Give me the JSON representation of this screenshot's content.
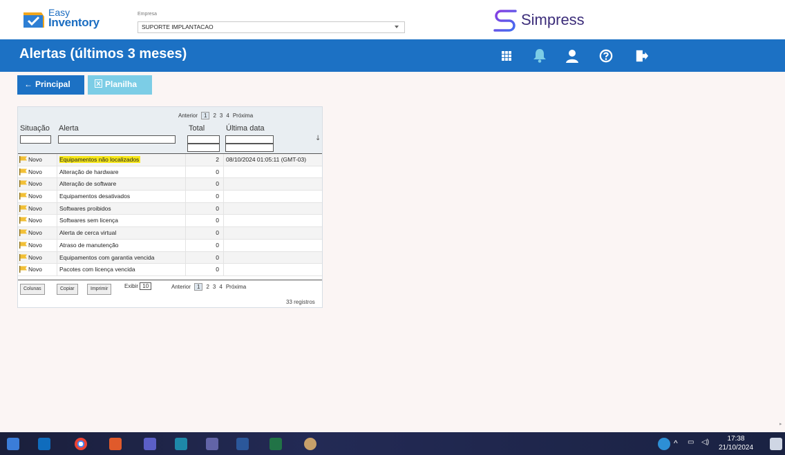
{
  "header": {
    "logo_line1": "Easy",
    "logo_line2": "Inventory",
    "company_label": "Empresa",
    "company_value": "SUPORTE IMPLANTACAO",
    "brand_name": "Simpress",
    "page_title": "Alertas (últimos 3 meses)",
    "icons": [
      "apps-grid-icon",
      "bell-icon",
      "user-icon",
      "help-icon",
      "logout-icon"
    ]
  },
  "toolbar": {
    "principal_label": "Principal",
    "planilha_label": "Planilha"
  },
  "pager": {
    "prev": "Anterior",
    "pages": [
      "1",
      "2",
      "3",
      "4"
    ],
    "current": "1",
    "next": "Próxima"
  },
  "table": {
    "columns": [
      "Situação",
      "Alerta",
      "Total",
      "Última data"
    ],
    "rows": [
      {
        "situacao": "Novo",
        "alerta": "Equipamentos não localizados",
        "total": "2",
        "data": "08/10/2024 01:05:11 (GMT-03)",
        "highlight": true
      },
      {
        "situacao": "Novo",
        "alerta": "Alteração de hardware",
        "total": "0",
        "data": ""
      },
      {
        "situacao": "Novo",
        "alerta": "Alteração de software",
        "total": "0",
        "data": ""
      },
      {
        "situacao": "Novo",
        "alerta": "Equipamentos desativados",
        "total": "0",
        "data": ""
      },
      {
        "situacao": "Novo",
        "alerta": "Softwares proibidos",
        "total": "0",
        "data": ""
      },
      {
        "situacao": "Novo",
        "alerta": "Softwares sem licença",
        "total": "0",
        "data": ""
      },
      {
        "situacao": "Novo",
        "alerta": "Alerta de cerca virtual",
        "total": "0",
        "data": ""
      },
      {
        "situacao": "Novo",
        "alerta": "Atraso de manutenção",
        "total": "0",
        "data": ""
      },
      {
        "situacao": "Novo",
        "alerta": "Equipamentos com garantia vencida",
        "total": "0",
        "data": ""
      },
      {
        "situacao": "Novo",
        "alerta": "Pacotes com licença vencida",
        "total": "0",
        "data": ""
      }
    ],
    "footer": {
      "colunas": "Colunas",
      "copiar": "Copiar",
      "imprimir": "Imprimir",
      "exibir_label": "Exibir",
      "exibir_value": "10",
      "registros": "33 registros"
    }
  },
  "taskbar": {
    "time": "17:38",
    "date": "21/10/2024"
  },
  "colors": {
    "primary": "#1c71c4",
    "planilha": "#7ccde6",
    "highlight": "#f6e71a",
    "flag": "#f2c037"
  }
}
